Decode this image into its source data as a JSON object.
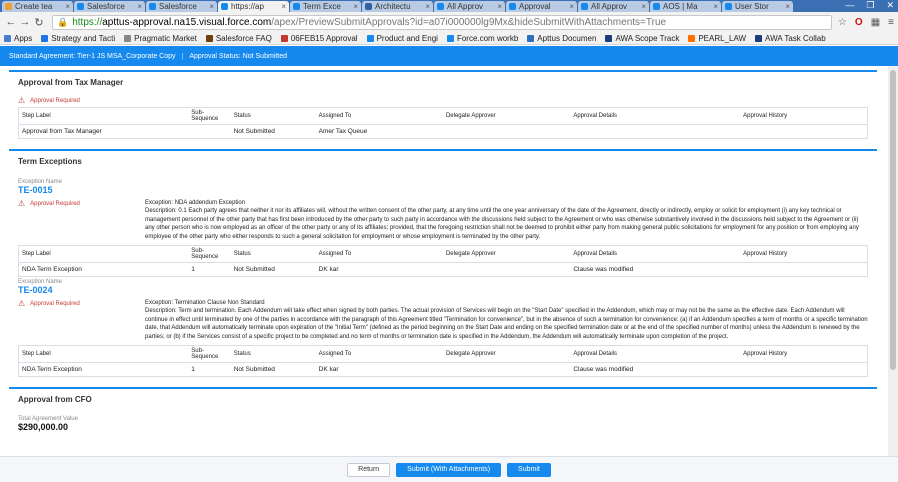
{
  "browser": {
    "tabs": [
      {
        "label": "Create tea",
        "color": "#f0a030",
        "active": false
      },
      {
        "label": "Salesforce",
        "color": "#1589ee",
        "active": false
      },
      {
        "label": "Salesforce",
        "color": "#1589ee",
        "active": false
      },
      {
        "label": "https://ap",
        "color": "#1589ee",
        "active": true
      },
      {
        "label": "Term Exce",
        "color": "#1589ee",
        "active": false
      },
      {
        "label": "Architectu",
        "color": "#3060a0",
        "active": false
      },
      {
        "label": "All Approv",
        "color": "#1589ee",
        "active": false
      },
      {
        "label": "Approval",
        "color": "#1589ee",
        "active": false
      },
      {
        "label": "All Approv",
        "color": "#1589ee",
        "active": false
      },
      {
        "label": "AOS | Ma",
        "color": "#1589ee",
        "active": false
      },
      {
        "label": "User Stor",
        "color": "#1589ee",
        "active": false
      }
    ],
    "url_scheme": "https://",
    "url_host": "apttus-approval.na15.visual.force.com",
    "url_path": "/apex/PreviewSubmitApprovals?id=a07i000000lg9Mx&hideSubmitWithAttachments=True",
    "bookmarks": [
      {
        "label": "Apps",
        "color": "#4a7fd0"
      },
      {
        "label": "Strategy and Tacti",
        "color": "#1a73e8"
      },
      {
        "label": "Pragmatic Market",
        "color": "#888888"
      },
      {
        "label": "Salesforce FAQ",
        "color": "#704010"
      },
      {
        "label": "06FEB15 Approval",
        "color": "#c23934"
      },
      {
        "label": "Product and Engi",
        "color": "#1589ee"
      },
      {
        "label": "Force.com workb",
        "color": "#1589ee"
      },
      {
        "label": "Apttus Documen",
        "color": "#2a6fc0"
      },
      {
        "label": "AWA Scope Track",
        "color": "#1c3e7a"
      },
      {
        "label": "PEARL_LAW",
        "color": "#ff6f00"
      },
      {
        "label": "AWA Task Collab",
        "color": "#1c3e7a"
      }
    ]
  },
  "header": {
    "agreement": "Standard Agreement: Tier-1 JS MSA_Corporate Copy",
    "status": "Approval Status: Not Submitted"
  },
  "columns": [
    "Step Label",
    "Sub-Sequence",
    "Status",
    "Assigned To",
    "Delegate Approver",
    "Approval Details",
    "Approval History"
  ],
  "tax": {
    "title": "Approval from Tax Manager",
    "required": "Approval Required",
    "row": [
      "Approval from Tax Manager",
      "",
      "Not Submitted",
      "Amer Tax Queue",
      "",
      "",
      ""
    ]
  },
  "term": {
    "title": "Term Exceptions",
    "name_label": "Exception Name",
    "exceptions": [
      {
        "id": "TE-0015",
        "required": "Approval Required",
        "exception_label": "Exception:",
        "exception": "NDA addendum Exception",
        "description_label": "Description:",
        "description": "0.1 Each party agrees that neither it nor its affiliates will, without the written consent of the other party, at any time until the one year anniversary of the date of the Agreement, directly or indirectly, employ or solicit for employment (i) any key technical or management personnel of the other party that has first been introduced by the other party to such party in accordance with the discussions held subject to the Agreement or who was otherwise substantively involved in the discussions held subject to the Agreement or (ii) any other person who is now employed as an officer of the other party or any of its affiliates; provided, that the foregoing restriction shall not be deemed to prohibit either party from making general public solicitations for employment for any position or from employing any employee of the other party who either responds to such a general solicitation for employment or whose employment is terminated by the other party.",
        "row": [
          "NDA Term Exception",
          "1",
          "Not Submitted",
          "DK kar",
          "",
          "Clause was modified",
          ""
        ]
      },
      {
        "id": "TE-0024",
        "required": "Approval Required",
        "exception_label": "Exception:",
        "exception": "Termination Clause Non Standard",
        "description_label": "Description:",
        "description": "Term and termination. Each Addendum will take effect when signed by both parties. The actual provision of Services will begin on the \"Start Date\" specified in the Addendum, which may or may not be the same as the effective date. Each Addendum will continue in effect until terminated by one of the parties in accordance with the paragraph of this Agreement titled \"Termination for convenience\", but in the absence of such a termination for convenience: (a) if an Addendum specifies a term of months or a specific termination date, that Addendum will automatically terminate upon expiration of the \"Initial Term\" (defined as the period beginning on the Start Date and ending on the specified termination date or at the end of the specified number of months) unless the Addendum is renewed by the parties; or (b) if the Services consist of a specific project to be completed and no term of months or termination date is specified in the Addendum, the Addendum will automatically terminate upon completion of the project.",
        "row": [
          "NDA Term Exception",
          "1",
          "Not Submitted",
          "DK kar",
          "",
          "Clause was modified",
          ""
        ]
      }
    ]
  },
  "cfo": {
    "title": "Approval from CFO",
    "total_label": "Total Agreement Value",
    "total_value": "$290,000.00"
  },
  "footer": {
    "return": "Return",
    "submit_attachments": "Submit (With Attachments)",
    "submit": "Submit"
  }
}
